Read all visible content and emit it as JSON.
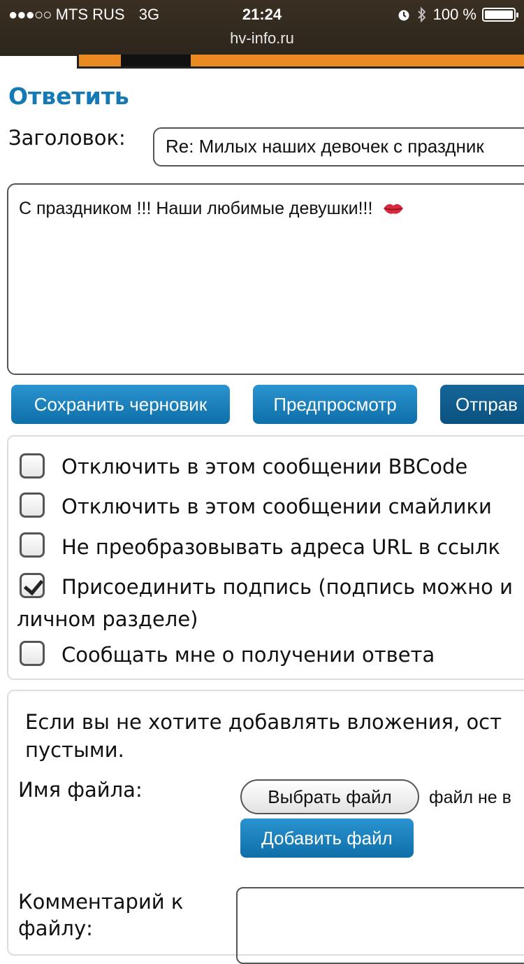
{
  "status_bar": {
    "signal_dots": "●●●○○",
    "carrier": "MTS RUS",
    "network": "3G",
    "time": "21:24",
    "battery_text": "100 %",
    "battery_level": 1.0,
    "url": "hv-info.ru",
    "icons": [
      "alarm-icon",
      "bluetooth-icon",
      "battery-icon"
    ]
  },
  "page": {
    "title": "Ответить",
    "subject_label": "Заголовок:",
    "subject_value": "Re: Милых наших девочек с праздник",
    "message_text": "С праздником !!! Наши любимые девушки!!!",
    "message_emoji": "kiss-lips-icon"
  },
  "buttons": {
    "save_draft": "Сохранить черновик",
    "preview": "Предпросмотр",
    "submit": "Отправ"
  },
  "options": [
    {
      "label": "Отключить в этом сообщении BBCode",
      "checked": false
    },
    {
      "label": "Отключить в этом сообщении смайлики",
      "checked": false
    },
    {
      "label": "Не преобразовывать адреса URL в ссылк",
      "checked": false
    },
    {
      "label": "Присоединить подпись (подпись можно и",
      "label_line2": "личном разделе)",
      "checked": true
    },
    {
      "label": "Сообщать мне о получении ответа",
      "checked": false
    }
  ],
  "attachments": {
    "note": "Если вы не хотите добавлять вложения, ост пустыми.",
    "file_label": "Имя файла:",
    "choose_file": "Выбрать файл",
    "file_status": "файл не в",
    "add_file": "Добавить файл",
    "comment_label": "Комментарий к файлу:"
  },
  "colors": {
    "accent": "#1479b5",
    "button": "#1a82bf",
    "submit_button": "#0f5e92",
    "banner": "#e98a22"
  }
}
